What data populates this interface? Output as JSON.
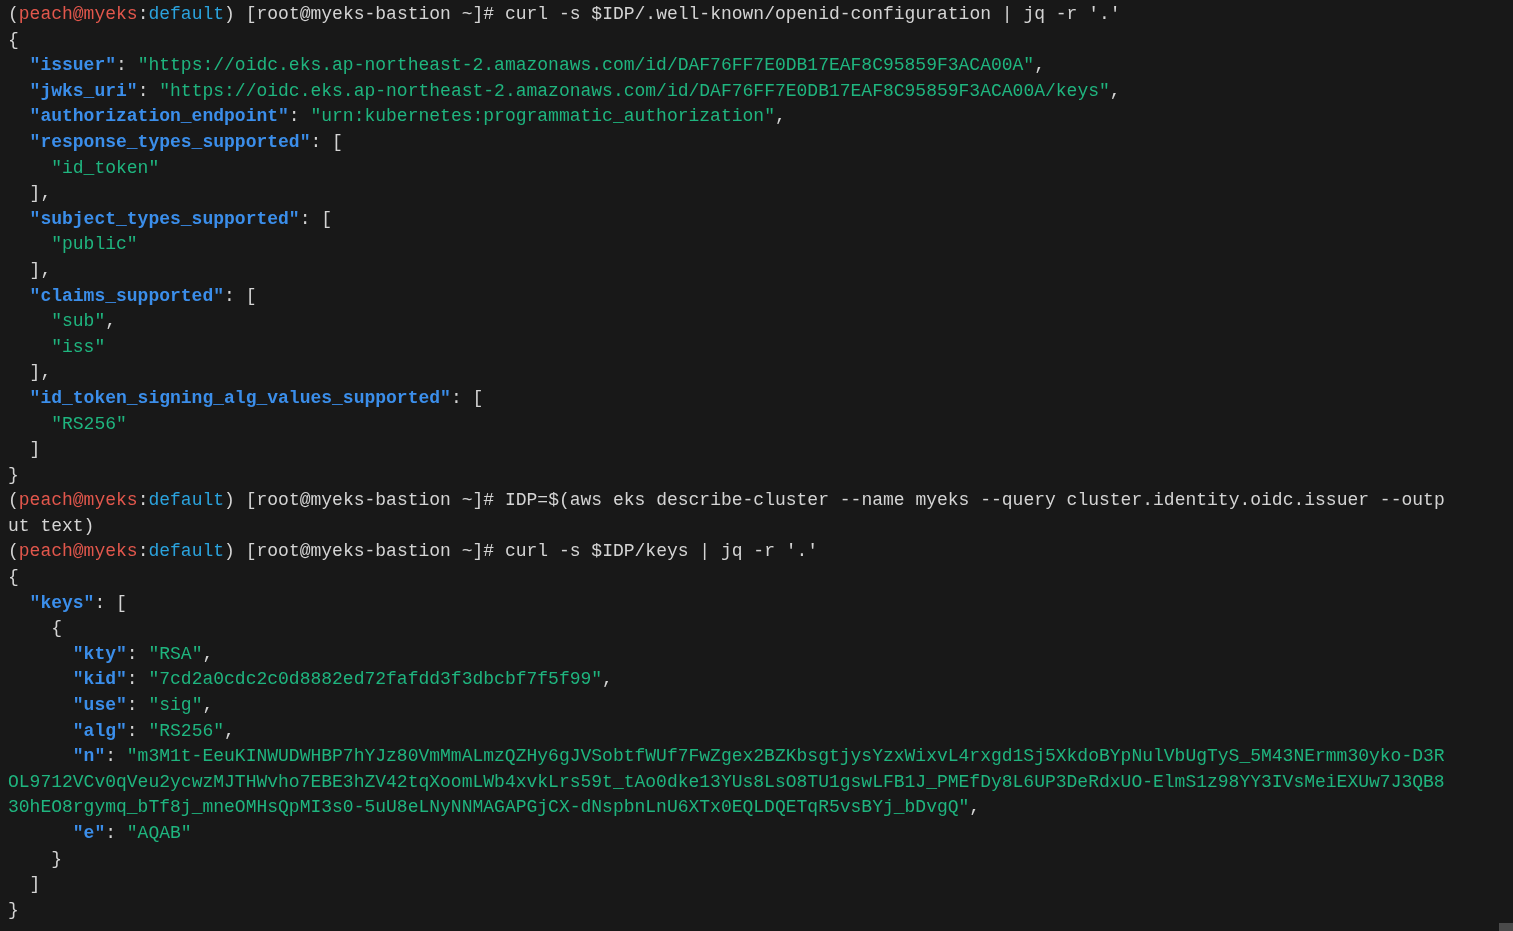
{
  "terminal": {
    "lines": [
      {
        "segments": [
          {
            "kind": "plain",
            "text": "("
          },
          {
            "kind": "user",
            "text": "peach@myeks"
          },
          {
            "kind": "plain",
            "text": ":"
          },
          {
            "kind": "context",
            "text": "default"
          },
          {
            "kind": "plain",
            "text": ") [root@myeks-bastion ~]# curl -s $IDP/.well-known/openid-configuration | jq -r '.'"
          }
        ]
      },
      {
        "segments": [
          {
            "kind": "plain",
            "text": "{"
          }
        ]
      },
      {
        "segments": [
          {
            "kind": "key",
            "text": "  \"issuer\""
          },
          {
            "kind": "plain",
            "text": ": "
          },
          {
            "kind": "string",
            "text": "\"https://oidc.eks.ap-northeast-2.amazonaws.com/id/DAF76FF7E0DB17EAF8C95859F3ACA00A\""
          },
          {
            "kind": "plain",
            "text": ","
          }
        ]
      },
      {
        "segments": [
          {
            "kind": "key",
            "text": "  \"jwks_uri\""
          },
          {
            "kind": "plain",
            "text": ": "
          },
          {
            "kind": "string",
            "text": "\"https://oidc.eks.ap-northeast-2.amazonaws.com/id/DAF76FF7E0DB17EAF8C95859F3ACA00A/keys\""
          },
          {
            "kind": "plain",
            "text": ","
          }
        ]
      },
      {
        "segments": [
          {
            "kind": "key",
            "text": "  \"authorization_endpoint\""
          },
          {
            "kind": "plain",
            "text": ": "
          },
          {
            "kind": "string",
            "text": "\"urn:kubernetes:programmatic_authorization\""
          },
          {
            "kind": "plain",
            "text": ","
          }
        ]
      },
      {
        "segments": [
          {
            "kind": "key",
            "text": "  \"response_types_supported\""
          },
          {
            "kind": "plain",
            "text": ": ["
          }
        ]
      },
      {
        "segments": [
          {
            "kind": "string",
            "text": "    \"id_token\""
          }
        ]
      },
      {
        "segments": [
          {
            "kind": "plain",
            "text": "  ],"
          }
        ]
      },
      {
        "segments": [
          {
            "kind": "key",
            "text": "  \"subject_types_supported\""
          },
          {
            "kind": "plain",
            "text": ": ["
          }
        ]
      },
      {
        "segments": [
          {
            "kind": "string",
            "text": "    \"public\""
          }
        ]
      },
      {
        "segments": [
          {
            "kind": "plain",
            "text": "  ],"
          }
        ]
      },
      {
        "segments": [
          {
            "kind": "key",
            "text": "  \"claims_supported\""
          },
          {
            "kind": "plain",
            "text": ": ["
          }
        ]
      },
      {
        "segments": [
          {
            "kind": "string",
            "text": "    \"sub\""
          },
          {
            "kind": "plain",
            "text": ","
          }
        ]
      },
      {
        "segments": [
          {
            "kind": "string",
            "text": "    \"iss\""
          }
        ]
      },
      {
        "segments": [
          {
            "kind": "plain",
            "text": "  ],"
          }
        ]
      },
      {
        "segments": [
          {
            "kind": "key",
            "text": "  \"id_token_signing_alg_values_supported\""
          },
          {
            "kind": "plain",
            "text": ": ["
          }
        ]
      },
      {
        "segments": [
          {
            "kind": "string",
            "text": "    \"RS256\""
          }
        ]
      },
      {
        "segments": [
          {
            "kind": "plain",
            "text": "  ]"
          }
        ]
      },
      {
        "segments": [
          {
            "kind": "plain",
            "text": "}"
          }
        ]
      },
      {
        "segments": [
          {
            "kind": "plain",
            "text": "("
          },
          {
            "kind": "user",
            "text": "peach@myeks"
          },
          {
            "kind": "plain",
            "text": ":"
          },
          {
            "kind": "context",
            "text": "default"
          },
          {
            "kind": "plain",
            "text": ") [root@myeks-bastion ~]# IDP=$(aws eks describe-cluster --name myeks --query cluster.identity.oidc.issuer --outp"
          }
        ]
      },
      {
        "segments": [
          {
            "kind": "plain",
            "text": "ut text)"
          }
        ]
      },
      {
        "segments": [
          {
            "kind": "plain",
            "text": "("
          },
          {
            "kind": "user",
            "text": "peach@myeks"
          },
          {
            "kind": "plain",
            "text": ":"
          },
          {
            "kind": "context",
            "text": "default"
          },
          {
            "kind": "plain",
            "text": ") [root@myeks-bastion ~]# curl -s $IDP/keys | jq -r '.'"
          }
        ]
      },
      {
        "segments": [
          {
            "kind": "plain",
            "text": "{"
          }
        ]
      },
      {
        "segments": [
          {
            "kind": "key",
            "text": "  \"keys\""
          },
          {
            "kind": "plain",
            "text": ": ["
          }
        ]
      },
      {
        "segments": [
          {
            "kind": "plain",
            "text": "    {"
          }
        ]
      },
      {
        "segments": [
          {
            "kind": "key",
            "text": "      \"kty\""
          },
          {
            "kind": "plain",
            "text": ": "
          },
          {
            "kind": "string",
            "text": "\"RSA\""
          },
          {
            "kind": "plain",
            "text": ","
          }
        ]
      },
      {
        "segments": [
          {
            "kind": "key",
            "text": "      \"kid\""
          },
          {
            "kind": "plain",
            "text": ": "
          },
          {
            "kind": "string",
            "text": "\"7cd2a0cdc2c0d8882ed72fafdd3f3dbcbf7f5f99\""
          },
          {
            "kind": "plain",
            "text": ","
          }
        ]
      },
      {
        "segments": [
          {
            "kind": "key",
            "text": "      \"use\""
          },
          {
            "kind": "plain",
            "text": ": "
          },
          {
            "kind": "string",
            "text": "\"sig\""
          },
          {
            "kind": "plain",
            "text": ","
          }
        ]
      },
      {
        "segments": [
          {
            "kind": "key",
            "text": "      \"alg\""
          },
          {
            "kind": "plain",
            "text": ": "
          },
          {
            "kind": "string",
            "text": "\"RS256\""
          },
          {
            "kind": "plain",
            "text": ","
          }
        ]
      },
      {
        "segments": [
          {
            "kind": "key",
            "text": "      \"n\""
          },
          {
            "kind": "plain",
            "text": ": "
          },
          {
            "kind": "string",
            "text": "\"m3M1t-EeuKINWUDWHBP7hYJz80VmMmALmzQZHy6gJVSobtfWUf7FwZgex2BZKbsgtjysYzxWixvL4rxgd1Sj5XkdoBYpNulVbUgTyS_5M43NErmm30yko-D3R"
          }
        ]
      },
      {
        "segments": [
          {
            "kind": "string",
            "text": "OL9712VCv0qVeu2ycwzMJTHWvho7EBE3hZV42tqXoomLWb4xvkLrs59t_tAo0dke13YUs8LsO8TU1gswLFB1J_PMEfDy8L6UP3DeRdxUO-ElmS1z98YY3IVsMeiEXUw7J3QB8"
          }
        ]
      },
      {
        "segments": [
          {
            "kind": "string",
            "text": "30hEO8rgymq_bTf8j_mneOMHsQpMI3s0-5uU8eLNyNNMAGAPGjCX-dNspbnLnU6XTx0EQLDQETqR5vsBYj_bDvgQ\""
          },
          {
            "kind": "plain",
            "text": ","
          }
        ]
      },
      {
        "segments": [
          {
            "kind": "key",
            "text": "      \"e\""
          },
          {
            "kind": "plain",
            "text": ": "
          },
          {
            "kind": "string",
            "text": "\"AQAB\""
          }
        ]
      },
      {
        "segments": [
          {
            "kind": "plain",
            "text": "    }"
          }
        ]
      },
      {
        "segments": [
          {
            "kind": "plain",
            "text": "  ]"
          }
        ]
      },
      {
        "segments": [
          {
            "kind": "plain",
            "text": "}"
          }
        ]
      }
    ]
  }
}
